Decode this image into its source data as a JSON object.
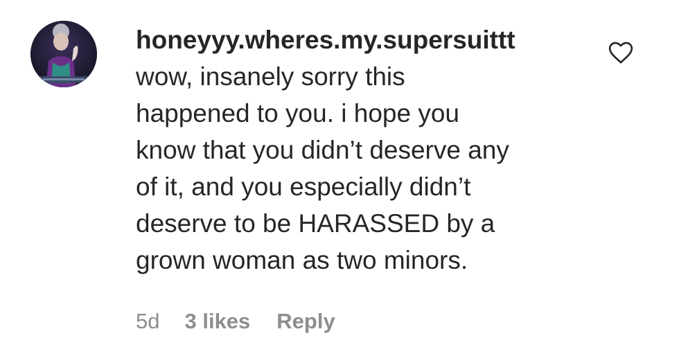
{
  "comment": {
    "username": "honeyyy.wheres.my.supersuittt",
    "text_lines": [
      "wow, insanely sorry this",
      "happened to you. i hope you",
      "know that you didn’t deserve any",
      "of it, and you especially didn’t",
      "deserve to be HARASSED by a",
      "grown woman as two minors."
    ],
    "time": "5d",
    "likes": "3 likes",
    "reply_label": "Reply",
    "like_icon": "heart-outline-icon"
  },
  "colors": {
    "text_primary": "#262626",
    "text_secondary": "#8e8e8e",
    "background": "#ffffff"
  }
}
